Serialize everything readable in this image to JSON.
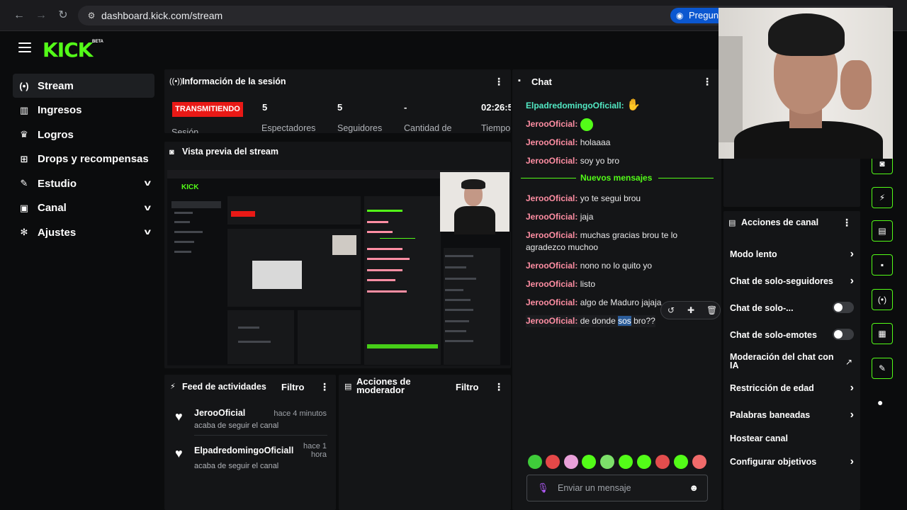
{
  "browser": {
    "url": "dashboard.kick.com/stream",
    "ask_label": "Pregunt"
  },
  "app": {
    "logo": "KICK",
    "logo_badge": "BETA"
  },
  "sidebar": {
    "items": [
      {
        "label": "Stream",
        "icon": "broadcast-icon"
      },
      {
        "label": "Ingresos",
        "icon": "chart-icon"
      },
      {
        "label": "Logros",
        "icon": "trophy-icon"
      },
      {
        "label": "Drops y recompensas",
        "icon": "gift-icon"
      },
      {
        "label": "Estudio",
        "icon": "brush-icon"
      },
      {
        "label": "Canal",
        "icon": "channel-icon"
      },
      {
        "label": "Ajustes",
        "icon": "gear-icon"
      }
    ]
  },
  "session": {
    "title": "Información de la sesión",
    "badge": "TRANSMITIENDO",
    "badge_label": "Sesión",
    "stats": [
      {
        "value": "5",
        "label": "Espectadores"
      },
      {
        "value": "5",
        "label": "Seguidores"
      },
      {
        "value": "-",
        "label": "Cantidad de"
      },
      {
        "value": "02:26:5",
        "label": "Tiempo"
      }
    ]
  },
  "preview": {
    "title": "Vista previa del stream"
  },
  "feed": {
    "title": "Feed de actividades",
    "filter": "Filtro",
    "items": [
      {
        "name": "JerooOficial",
        "time": "hace 4 minutos",
        "sub": "acaba de seguir el canal"
      },
      {
        "name": "ElpadredomingoOficiall",
        "time_line1": "hace 1",
        "time_line2": "hora",
        "sub": "acaba de seguir el canal"
      }
    ]
  },
  "mod_actions": {
    "title_line1": "Acciones de",
    "title_line2": "moderador",
    "filter": "Filtro"
  },
  "chat": {
    "title": "Chat",
    "new_messages": "Nuevos mensajes",
    "messages": [
      {
        "user": "ElpadredomingoOficiall:",
        "text": ""
      },
      {
        "user": "JerooOficial:",
        "text": ""
      },
      {
        "user": "JerooOficial:",
        "text": " holaaaa"
      },
      {
        "user": "JerooOficial:",
        "text": " soy yo bro"
      },
      {
        "user": "JerooOficial:",
        "text": " yo te segui brou"
      },
      {
        "user": "JerooOficial:",
        "text": " jaja"
      },
      {
        "user": "JerooOficial:",
        "text": " muchas gracias brou te lo agradezco muchoo"
      },
      {
        "user": "JerooOficial:",
        "text": " nono no lo quito yo"
      },
      {
        "user": "JerooOficial:",
        "text": " listo"
      },
      {
        "user": "JerooOficial:",
        "text": " algo de Maduro jajaja"
      },
      {
        "user": "JerooOficial:",
        "text_before": " de donde ",
        "text_highlight": "sos",
        "text_after": " bro??"
      }
    ],
    "input_placeholder": "Enviar un mensaje"
  },
  "channel_actions": {
    "title": "Acciones de canal",
    "items": [
      {
        "label": "Modo lento",
        "control": "chevron"
      },
      {
        "label": "Chat de solo-seguidores",
        "control": "chevron"
      },
      {
        "label": "Chat de solo-...",
        "control": "toggle",
        "on": false
      },
      {
        "label": "Chat de solo-emotes",
        "control": "toggle",
        "on": false
      },
      {
        "label": "Moderación del chat con IA",
        "control": "external"
      },
      {
        "label": "Restricción de edad",
        "control": "chevron"
      },
      {
        "label": "Palabras baneadas",
        "control": "chevron"
      },
      {
        "label": "Hostear canal",
        "control": "none"
      },
      {
        "label": "Configurar objetivos",
        "control": "chevron"
      }
    ]
  },
  "colors": {
    "brand": "#53fc18",
    "live": "#e91916",
    "username": "#ff8ea3"
  }
}
